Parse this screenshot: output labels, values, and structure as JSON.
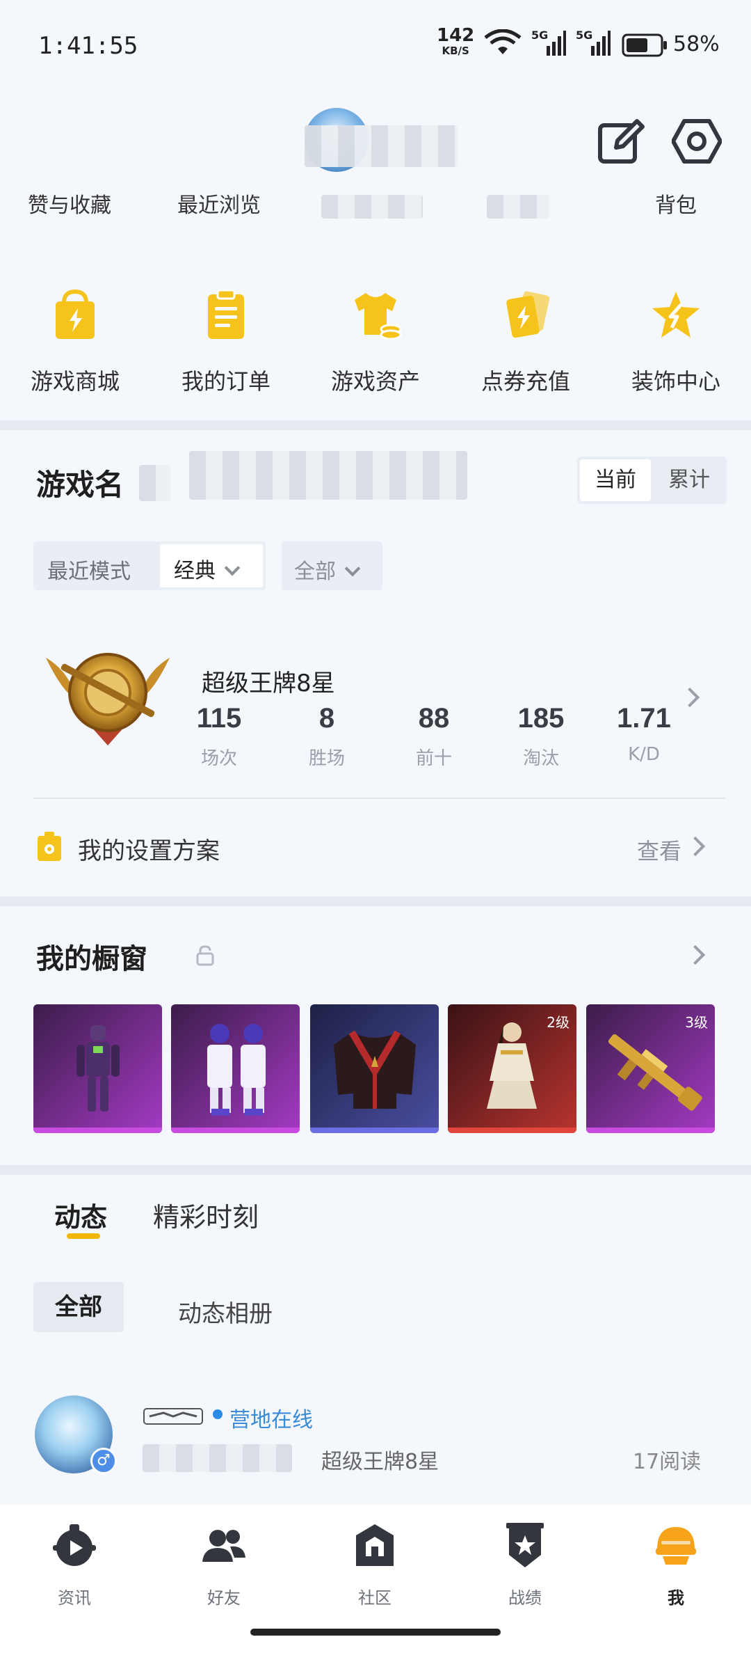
{
  "status_bar": {
    "time": "1:41:55",
    "net_speed": "142",
    "net_unit": "KB/S",
    "network": "5G",
    "battery": "58%"
  },
  "header": {
    "quick_links": [
      "赞与收藏",
      "最近浏览",
      "背包"
    ]
  },
  "shortcuts": [
    {
      "label": "游戏商城",
      "icon": "shopping-bag-icon"
    },
    {
      "label": "我的订单",
      "icon": "order-list-icon"
    },
    {
      "label": "游戏资产",
      "icon": "tshirt-coins-icon"
    },
    {
      "label": "点券充值",
      "icon": "voucher-cards-icon"
    },
    {
      "label": "装饰中心",
      "icon": "star-badge-icon"
    }
  ],
  "game_stats": {
    "title": "游戏名",
    "toggle": {
      "current": "当前",
      "total": "累计"
    },
    "filter_mode_label": "最近模式",
    "filter_mode_value": "经典",
    "filter_scope_value": "全部",
    "rank_name": "超级王牌8星",
    "stats": [
      {
        "value": "115",
        "label": "场次"
      },
      {
        "value": "8",
        "label": "胜场"
      },
      {
        "value": "88",
        "label": "前十"
      },
      {
        "value": "185",
        "label": "淘汰"
      },
      {
        "value": "1.71",
        "label": "K/D"
      }
    ],
    "settings_label": "我的设置方案",
    "settings_view": "查看"
  },
  "showcase": {
    "title": "我的橱窗",
    "items": [
      {
        "level": "",
        "colors": [
          "#5a2a6a",
          "#b43ad0"
        ],
        "accent": "#c84ce0"
      },
      {
        "level": "",
        "colors": [
          "#5a2a6a",
          "#b43ad0"
        ],
        "accent": "#c84ce0"
      },
      {
        "level": "",
        "colors": [
          "#2a2d55",
          "#4a4ea0"
        ],
        "accent": "#6a6ee0"
      },
      {
        "level": "2级",
        "colors": [
          "#4a1a1e",
          "#c23a34"
        ],
        "accent": "#e0463c"
      },
      {
        "level": "3级",
        "colors": [
          "#5a2a6a",
          "#b43ad0"
        ],
        "accent": "#c84ce0"
      }
    ]
  },
  "feed": {
    "tabs": [
      "动态",
      "精彩时刻"
    ],
    "subtabs": [
      "全部",
      "动态相册"
    ],
    "post": {
      "status": "营地在线",
      "rank": "超级王牌8星",
      "reads": "17阅读"
    }
  },
  "bottom_nav": [
    {
      "label": "资讯",
      "icon": "news-play-icon"
    },
    {
      "label": "好友",
      "icon": "friends-icon"
    },
    {
      "label": "社区",
      "icon": "community-icon"
    },
    {
      "label": "战绩",
      "icon": "record-shield-icon"
    },
    {
      "label": "我",
      "icon": "helmet-profile-icon"
    }
  ],
  "colors": {
    "accent_yellow": "#f6c31b",
    "dark_icon": "#33363d",
    "online_blue": "#3a8bd6"
  }
}
